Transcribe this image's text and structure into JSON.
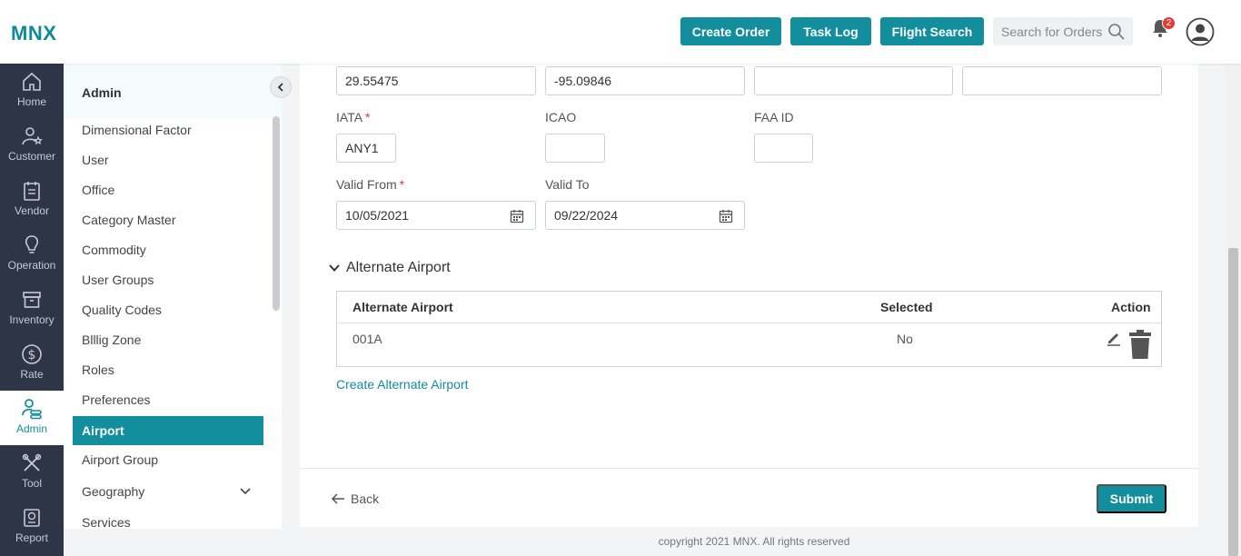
{
  "header": {
    "logo": "MNX",
    "buttons": {
      "create_order": "Create Order",
      "task_log": "Task Log",
      "flight_search": "Flight Search"
    },
    "search_placeholder": "Search for Orders",
    "notification_count": "2"
  },
  "rail": [
    {
      "label": "Home",
      "icon": "home-icon"
    },
    {
      "label": "Customer",
      "icon": "customer-icon"
    },
    {
      "label": "Vendor",
      "icon": "vendor-icon"
    },
    {
      "label": "Operation",
      "icon": "bulb-icon"
    },
    {
      "label": "Inventory",
      "icon": "inventory-icon"
    },
    {
      "label": "Rate",
      "icon": "dollar-icon"
    },
    {
      "label": "Admin",
      "icon": "admin-icon"
    },
    {
      "label": "Tool",
      "icon": "tool-icon"
    },
    {
      "label": "Report",
      "icon": "report-icon"
    }
  ],
  "subnav": {
    "title": "Admin",
    "items": [
      "Dimensional Factor",
      "User",
      "Office",
      "Category Master",
      "Commodity",
      "User Groups",
      "Quality Codes",
      "Blllig Zone",
      "Roles",
      "Preferences",
      "Airport",
      "Airport Group",
      "Geography",
      "Services"
    ],
    "active": "Airport"
  },
  "form": {
    "latitude": "29.55475",
    "longitude": "-95.09846",
    "field3": "",
    "field4": "",
    "iata_label": "IATA",
    "iata": "ANY1",
    "icao_label": "ICAO",
    "icao": "",
    "faa_label": "FAA ID",
    "faa": "",
    "valid_from_label": "Valid From",
    "valid_from": "10/05/2021",
    "valid_to_label": "Valid To",
    "valid_to": "09/22/2024",
    "required_mark": "*"
  },
  "alternate": {
    "section_title": "Alternate Airport",
    "columns": {
      "airport": "Alternate Airport",
      "selected": "Selected",
      "action": "Action"
    },
    "rows": [
      {
        "airport": "001A",
        "selected": "No"
      }
    ],
    "create_link": "Create Alternate Airport"
  },
  "footer": {
    "back": "Back",
    "submit": "Submit",
    "copyright": "copyright 2021 MNX. All rights reserved"
  },
  "colors": {
    "accent": "#128e9d",
    "rail": "#2d3546",
    "badge": "#e53935"
  }
}
